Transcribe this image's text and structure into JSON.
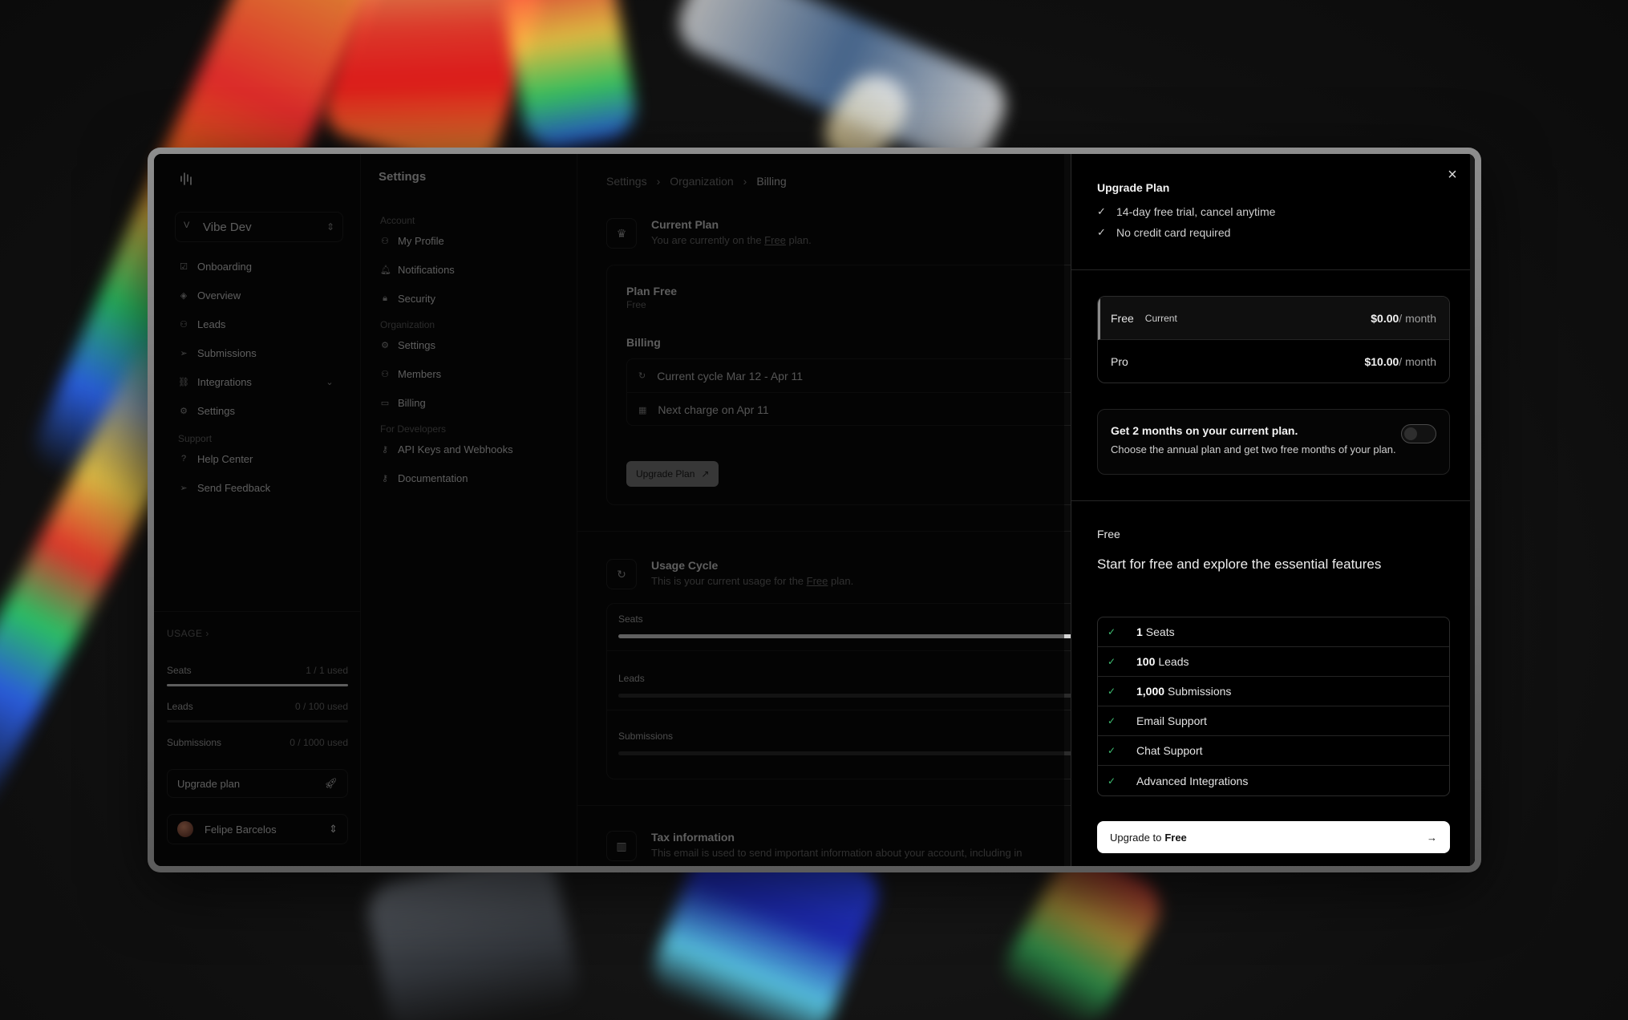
{
  "workspace": {
    "initial": "V",
    "name": "Vibe Dev"
  },
  "sidebar": {
    "items": [
      {
        "label": "Onboarding",
        "icon": "square-check-icon"
      },
      {
        "label": "Overview",
        "icon": "layers-icon"
      },
      {
        "label": "Leads",
        "icon": "user-icon"
      },
      {
        "label": "Submissions",
        "icon": "send-icon"
      },
      {
        "label": "Integrations",
        "icon": "link-icon"
      },
      {
        "label": "Settings",
        "icon": "gear-icon"
      }
    ],
    "support_label": "Support",
    "support_items": [
      {
        "label": "Help Center",
        "icon": "help-icon"
      },
      {
        "label": "Send Feedback",
        "icon": "send-icon"
      }
    ],
    "usage": {
      "title": "USAGE",
      "rows": [
        {
          "label": "Seats",
          "value": "1 / 1 used",
          "fraction": 1
        },
        {
          "label": "Leads",
          "value": "0 / 100 used",
          "fraction": 0
        },
        {
          "label": "Submissions",
          "value": "0 / 1000 used",
          "fraction": 0
        }
      ],
      "upgrade_label": "Upgrade plan",
      "user_name": "Felipe Barcelos"
    }
  },
  "settings_menu": {
    "title": "Settings",
    "account_label": "Account",
    "account_items": [
      "My Profile",
      "Notifications",
      "Security"
    ],
    "org_label": "Organization",
    "org_items": [
      "Settings",
      "Members",
      "Billing"
    ],
    "dev_label": "For Developers",
    "dev_items": [
      "API Keys and Webhooks",
      "Documentation"
    ]
  },
  "main": {
    "breadcrumb": [
      "Settings",
      "Organization",
      "Billing"
    ],
    "current_plan": {
      "title": "Current Plan",
      "sub_prefix": "You are currently on the ",
      "sub_link": "Free",
      "sub_suffix": " plan.",
      "plan_name": "Plan Free",
      "plan_sub": "Free",
      "billing_label": "Billing",
      "cycle": "Current cycle Mar 12 - Apr 11",
      "next_charge": "Next charge on Apr 11",
      "upgrade_button": "Upgrade Plan"
    },
    "usage_cycle": {
      "title": "Usage Cycle",
      "sub_prefix": "This is your current usage for the ",
      "sub_link": "Free",
      "sub_suffix": " plan.",
      "rows": [
        {
          "label": "Seats",
          "fraction": 1
        },
        {
          "label": "Leads",
          "fraction": 0
        },
        {
          "label": "Submissions",
          "fraction": 0
        }
      ]
    },
    "tax": {
      "title": "Tax information",
      "sub": "This email is used to send important information about your account, including in"
    }
  },
  "upgrade_panel": {
    "title": "Upgrade Plan",
    "perks": [
      "14-day free trial, cancel anytime",
      "No credit card required"
    ],
    "plans": [
      {
        "name": "Free",
        "tag": "Current",
        "price": "$0.00",
        "period": "/ month",
        "selected": true
      },
      {
        "name": "Pro",
        "tag": "",
        "price": "$10.00",
        "period": "/ month",
        "selected": false
      }
    ],
    "annual": {
      "title": "Get 2 months on your current plan.",
      "sub": "Choose the annual plan and get two free months of your plan.",
      "enabled": false
    },
    "tier_name": "Free",
    "tier_description": "Start for free and explore the essential features",
    "features": [
      {
        "bold": "1",
        "text": "Seats"
      },
      {
        "bold": "100",
        "text": "Leads"
      },
      {
        "bold": "1,000",
        "text": "Submissions"
      },
      {
        "bold": "",
        "text": "Email Support"
      },
      {
        "bold": "",
        "text": "Chat Support"
      },
      {
        "bold": "",
        "text": "Advanced Integrations"
      }
    ],
    "cta_prefix": "Upgrade to",
    "cta_plan": "Free"
  },
  "colors": {
    "accent_check": "#3fbf73",
    "panel_bg": "#000000",
    "cta_bg": "#ffffff"
  }
}
